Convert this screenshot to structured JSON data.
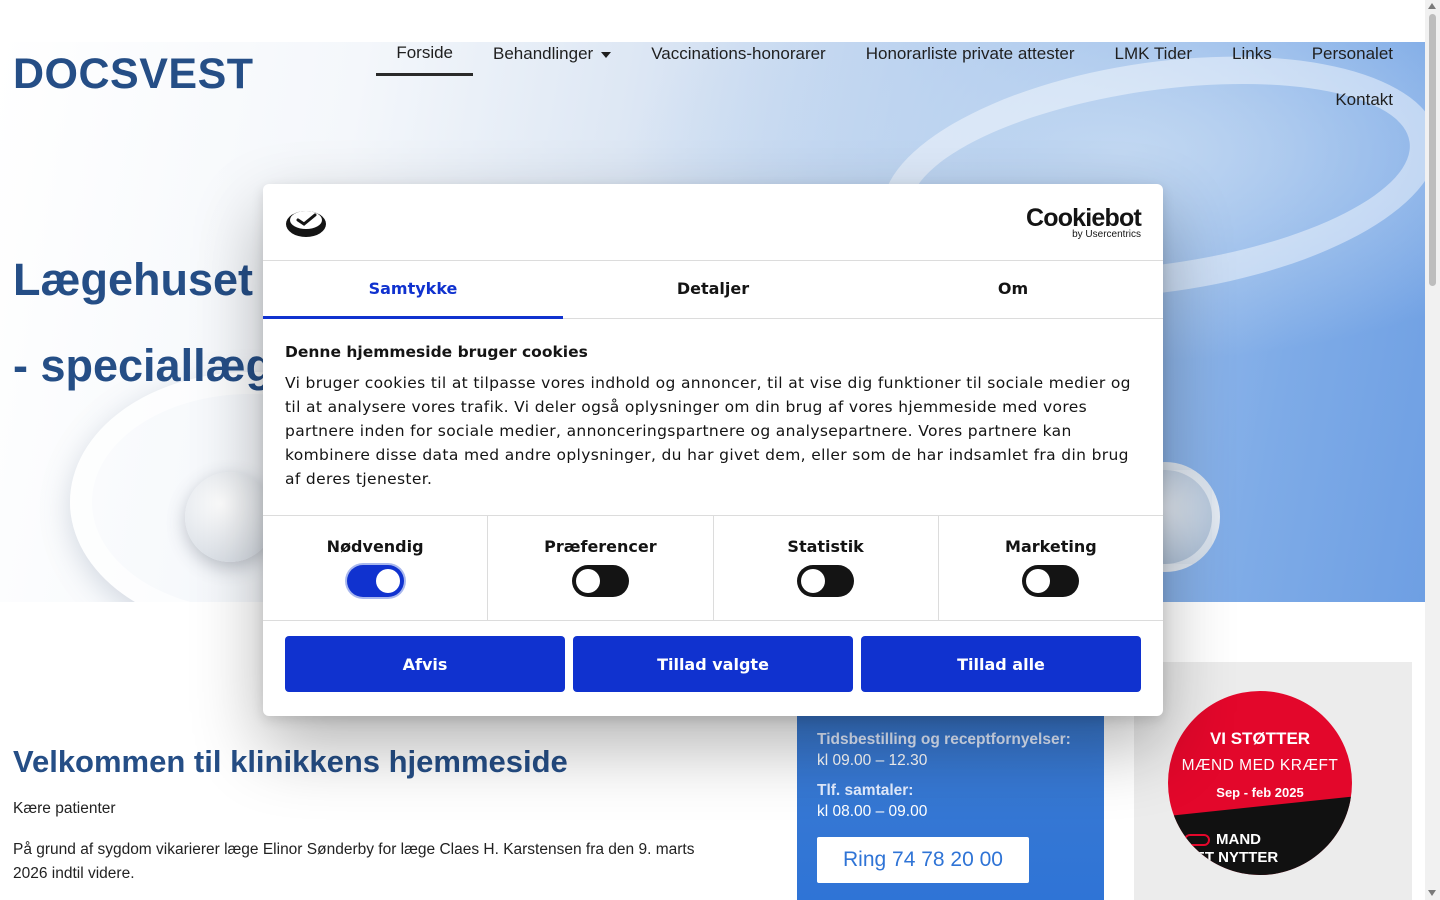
{
  "site": {
    "logo": "DOCSVEST",
    "nav": [
      {
        "label": "Forside",
        "active": true
      },
      {
        "label": "Behandlinger",
        "has_dropdown": true
      },
      {
        "label": "Vaccinations-honorarer"
      },
      {
        "label": "Honorarliste private attester"
      },
      {
        "label": "LMK Tider"
      },
      {
        "label": "Links"
      },
      {
        "label": "Personalet"
      },
      {
        "label": "Kontakt"
      }
    ],
    "hero": {
      "title_visible": "Lægehuset I",
      "subtitle_visible": "- speciallæge"
    },
    "content": {
      "heading": "Velkommen til klinikkens hjemmeside",
      "greeting": "Kære patienter",
      "paragraph": "På grund af sygdom vikarierer læge Elinor Sønderby for læge Claes H. Karstensen fra den 9. marts 2026 indtil videre."
    },
    "info_box": {
      "booking_label": "Tidsbestilling og receptfornyelser:",
      "booking_hours": "kl 09.00 – 12.30",
      "phone_label": "Tlf. samtaler:",
      "phone_hours": "kl 08.00 – 09.00",
      "call_button": "Ring 74 78 20 00",
      "color": "#2f74d6"
    },
    "campaign_badge": {
      "line1": "VI STØTTER",
      "line2": "MÆND MED KRÆFT",
      "line3": "Sep - feb 2025",
      "line4a": "MAND",
      "line4b": "DET NYTTER",
      "color": "#e3072b"
    }
  },
  "cookie_dialog": {
    "brand_name": "Cookiebot",
    "brand_sub": "by Usercentrics",
    "tabs": [
      {
        "label": "Samtykke",
        "active": true
      },
      {
        "label": "Detaljer",
        "active": false
      },
      {
        "label": "Om",
        "active": false
      }
    ],
    "title": "Denne hjemmeside bruger cookies",
    "text": "Vi bruger cookies til at tilpasse vores indhold og annoncer, til at vise dig funktioner til sociale medier og til at analysere vores trafik. Vi deler også oplysninger om din brug af vores hjemmeside med vores partnere inden for sociale medier, annonceringspartnere og analysepartnere. Vores partnere kan kombinere disse data med andre oplysninger, du har givet dem, eller som de har indsamlet fra din brug af deres tjenester.",
    "toggles": [
      {
        "label": "Nødvendig",
        "on": true
      },
      {
        "label": "Præferencer",
        "on": false
      },
      {
        "label": "Statistik",
        "on": false
      },
      {
        "label": "Marketing",
        "on": false
      }
    ],
    "buttons": {
      "decline": "Afvis",
      "allow_selected": "Tillad valgte",
      "allow_all": "Tillad alle"
    },
    "accent_color": "#1032cf"
  }
}
